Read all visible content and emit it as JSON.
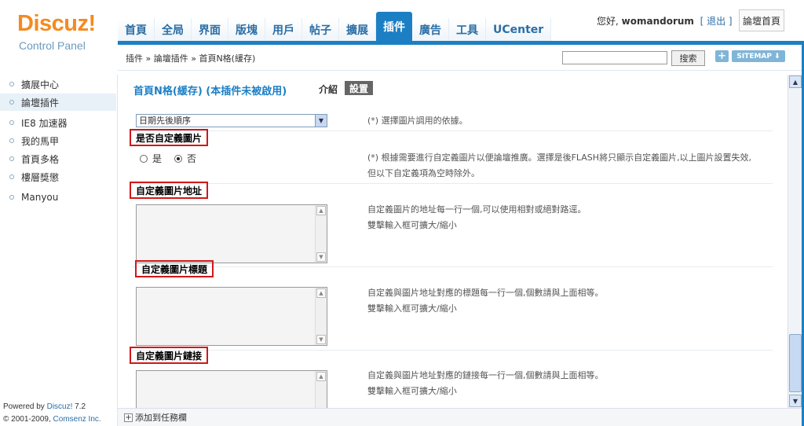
{
  "logo": {
    "brand": "Discuz!",
    "subtitle": "Control Panel"
  },
  "nav": {
    "items": [
      {
        "label": "首頁"
      },
      {
        "label": "全局"
      },
      {
        "label": "界面"
      },
      {
        "label": "版塊"
      },
      {
        "label": "用戶"
      },
      {
        "label": "帖子"
      },
      {
        "label": "擴展"
      },
      {
        "label": "插件"
      },
      {
        "label": "廣告"
      },
      {
        "label": "工具"
      },
      {
        "label": "UCenter"
      }
    ],
    "active_index": 7
  },
  "user": {
    "greeting": "您好,",
    "username": "womandorum",
    "logout": "[ 退出 ]",
    "home_button": "論壇首頁"
  },
  "breadcrumb": "插件 » 論壇插件 » 首頁N格(緩存)",
  "search": {
    "value": "",
    "button": "搜索"
  },
  "sitemap": {
    "plus": "+",
    "label": "SITEMAP ⬇"
  },
  "sidebar": {
    "items": [
      {
        "label": "擴展中心"
      },
      {
        "label": "論壇插件"
      },
      {
        "label": "IE8 加速器"
      },
      {
        "label": "我的馬甲"
      },
      {
        "label": "首頁多格"
      },
      {
        "label": "樓層獎懲"
      },
      {
        "label": "Manyou"
      }
    ],
    "active_index": 1
  },
  "footer": {
    "powered_prefix": "Powered by ",
    "powered_brand": "Discuz!",
    "version": " 7.2",
    "copyright_prefix": "© 2001-2009, ",
    "copyright_brand": "Comsenz Inc."
  },
  "main": {
    "title": "首頁N格(緩存) (本插件未被啟用)",
    "tab_intro": "介紹",
    "tab_settings": "設置",
    "order_select": {
      "value": "日期先後順序",
      "desc": "(*) 選擇圖片調用的依據。"
    },
    "custom_image": {
      "label": "是否自定義圖片",
      "yes": "是",
      "no": "否",
      "selected": "否",
      "desc1": "(*) 根據需要進行自定義圖片以便論壇推廣。選擇是後FLASH將只顯示自定義圖片,以上圖片設置失效,",
      "desc2": "但以下自定義項為空時除外。"
    },
    "image_url": {
      "label": "自定義圖片地址",
      "desc1": "自定義圖片的地址每一行一個,可以使用相對或絕對路逕。",
      "desc2": "雙擊輸入框可擴大/縮小"
    },
    "image_title": {
      "label": "自定義圖片標題",
      "desc1": "自定義與圖片地址對應的標題每一行一個,個數請與上面相等。",
      "desc2": "雙擊輸入框可擴大/縮小"
    },
    "image_link": {
      "label": "自定義圖片鏈接",
      "desc1": "自定義與圖片地址對應的鏈接每一行一個,個數請與上面相等。",
      "desc2": "雙擊輸入框可擴大/縮小"
    }
  },
  "taskbar": {
    "add": "添加到任務欄"
  },
  "colors": {
    "accent": "#1c7fc4",
    "logo_orange": "#f58a1f",
    "highlight_red": "#d01818"
  }
}
